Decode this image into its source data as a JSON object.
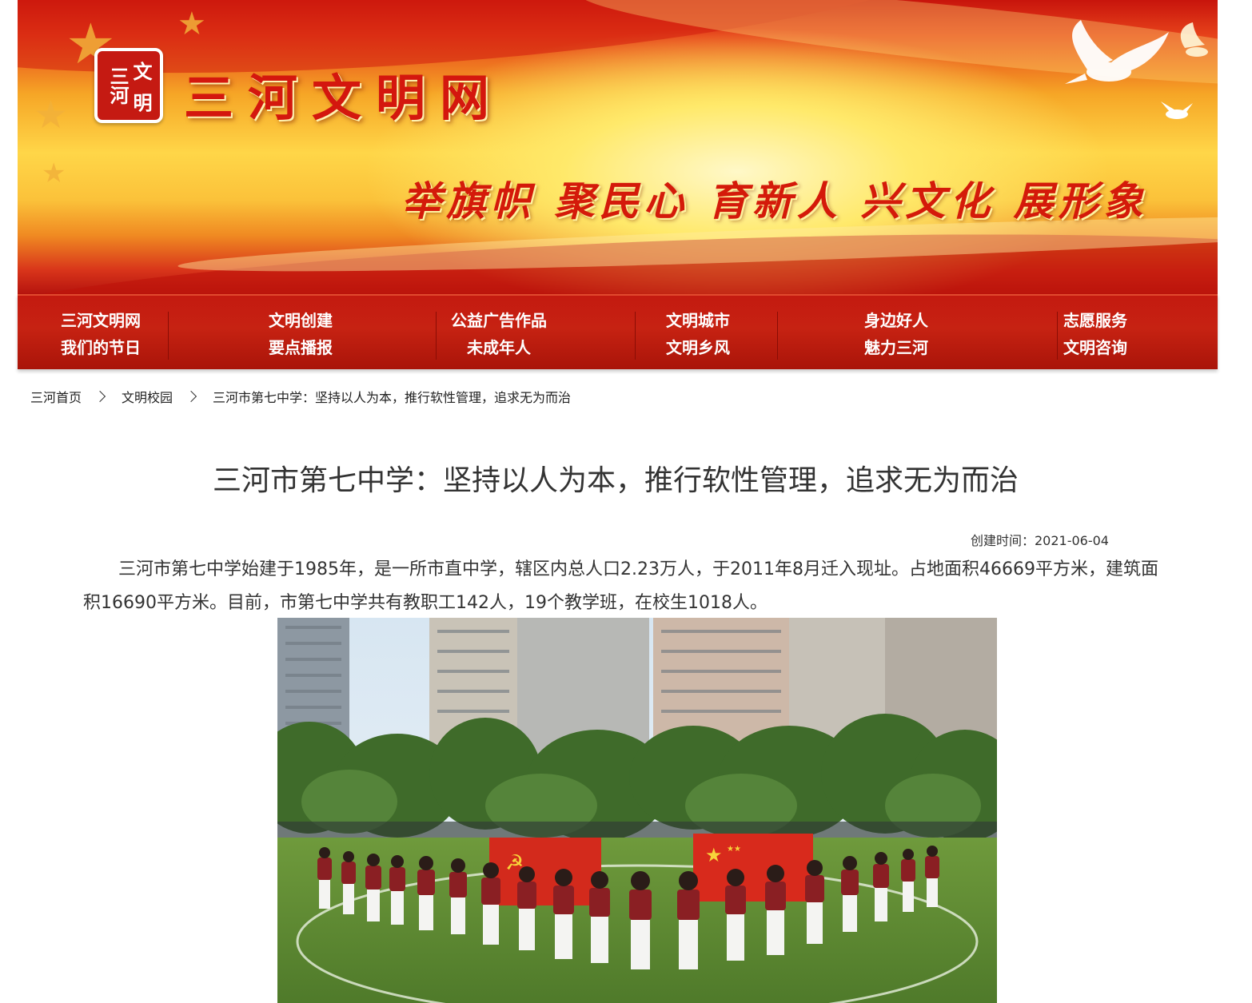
{
  "site": {
    "title": "三河文明网",
    "slogan": "举旗帜 聚民心 育新人 兴文化 展形象",
    "seal_chars": [
      "文",
      "三河",
      "明"
    ],
    "colors": {
      "primary_red": "#c41a10",
      "gold": "#ffd648"
    }
  },
  "nav": {
    "columns": [
      {
        "top": "三河文明网",
        "bottom": "我们的节日"
      },
      {
        "top": "文明创建",
        "bottom": "要点播报"
      },
      {
        "top": "公益广告作品",
        "bottom": "未成年人"
      },
      {
        "top": "文明城市",
        "bottom": "文明乡风"
      },
      {
        "top": "身边好人",
        "bottom": "魅力三河"
      },
      {
        "top": "志愿服务",
        "bottom": "文明咨询"
      }
    ]
  },
  "breadcrumb": {
    "items": [
      "三河首页",
      "文明校园",
      "三河市第七中学：坚持以人为本，推行软性管理，追求无为而治"
    ]
  },
  "article": {
    "title": "三河市第七中学：坚持以人为本，推行软性管理，追求无为而治",
    "meta": "创建时间：2021-06-04",
    "paragraph": "三河市第七中学始建于1985年，是一所市直中学，辖区内总人口2.23万人，于2011年8月迁入现址。占地面积46669平方米，建筑面积16690平方米。目前，市第七中学共有教职工142人，19个教学班，在校生1018人。",
    "photo_icon": "school-students-photo"
  }
}
